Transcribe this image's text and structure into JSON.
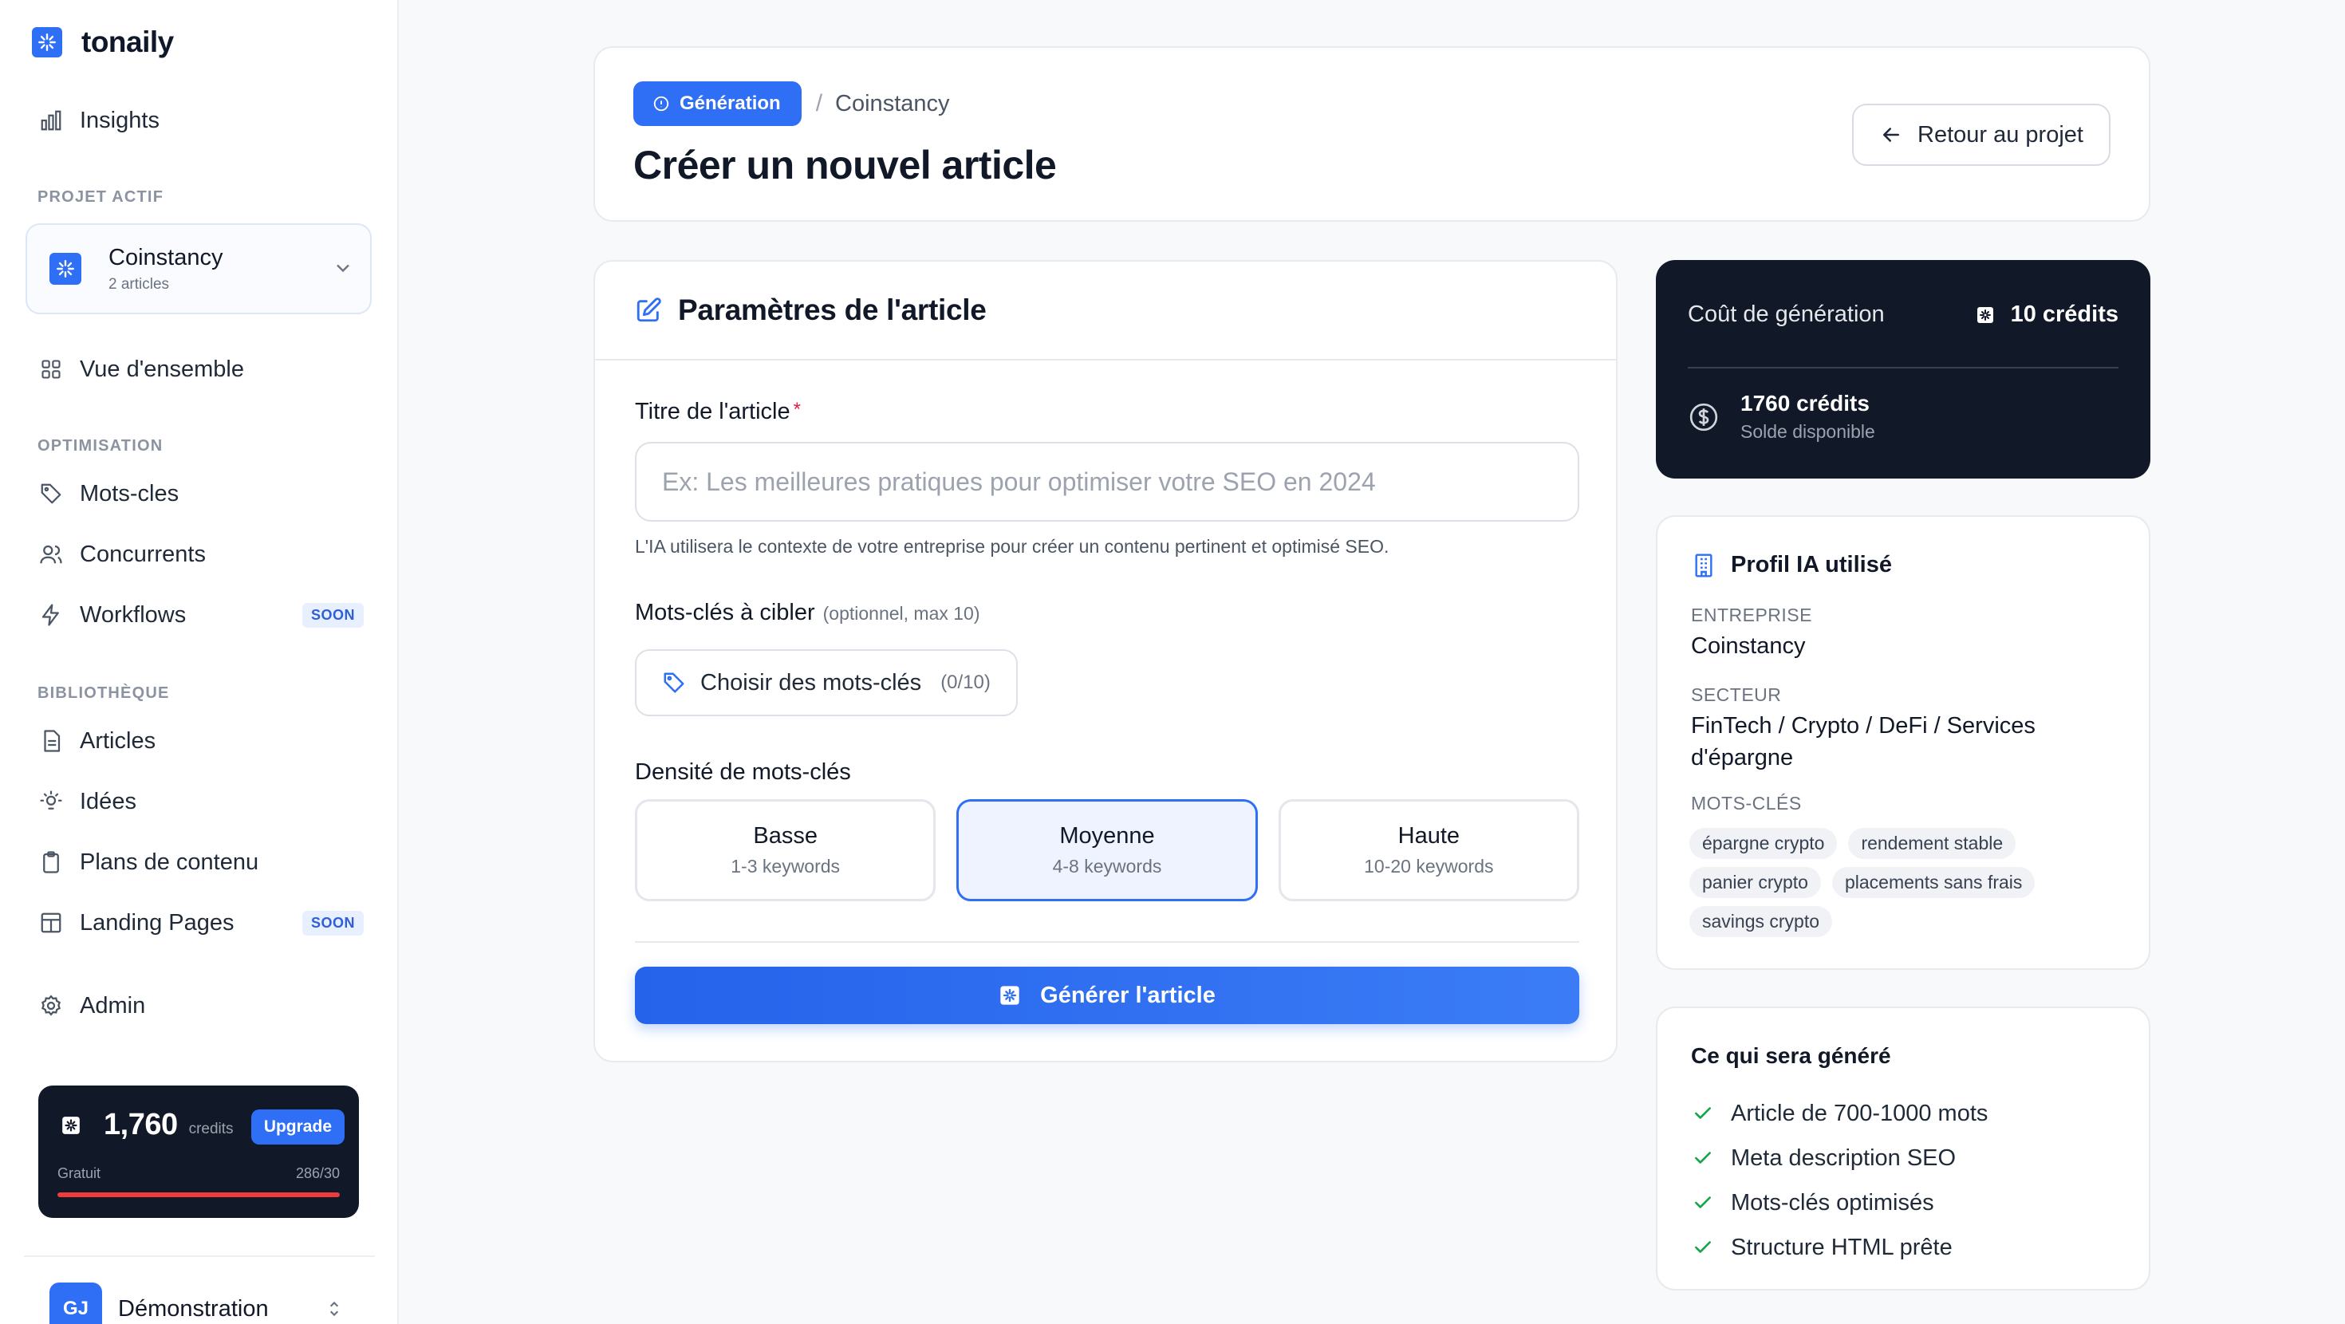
{
  "brand": {
    "name": "tonaily"
  },
  "sidebar": {
    "insights": "Insights",
    "active_project_label": "PROJET ACTIF",
    "project": {
      "name": "Coinstancy",
      "sub": "2 articles"
    },
    "overview": "Vue d'ensemble",
    "optimisation_label": "OPTIMISATION",
    "optimisation_items": [
      {
        "label": "Mots-cles",
        "icon": "tag-icon"
      },
      {
        "label": "Concurrents",
        "icon": "users-icon"
      },
      {
        "label": "Workflows",
        "icon": "bolt-icon",
        "badge": "SOON"
      }
    ],
    "library_label": "BIBLIOTHÈQUE",
    "library_items": [
      {
        "label": "Articles",
        "icon": "file-icon"
      },
      {
        "label": "Idées",
        "icon": "lightbulb-icon"
      },
      {
        "label": "Plans de contenu",
        "icon": "clipboard-icon"
      },
      {
        "label": "Landing Pages",
        "icon": "layout-icon",
        "badge": "SOON"
      }
    ],
    "admin": "Admin",
    "credits": {
      "amount": "1,760",
      "unit": "credits",
      "upgrade": "Upgrade",
      "plan": "Gratuit",
      "usage": "286/30",
      "usage_fraction": 1.0
    },
    "user": {
      "initials": "GJ",
      "name": "Démonstration"
    }
  },
  "header": {
    "badge": "Génération",
    "separator": "/",
    "breadcrumb_current": "Coinstancy",
    "title": "Créer un nouvel article",
    "back_button": "Retour au projet"
  },
  "form": {
    "section_title": "Paramètres de l'article",
    "title_label": "Titre de l'article",
    "required_mark": "*",
    "title_placeholder": "Ex: Les meilleures pratiques pour optimiser votre SEO en 2024",
    "title_value": "",
    "help": "L'IA utilisera le contexte de votre entreprise pour créer un contenu pertinent et optimisé SEO.",
    "keywords_label": "Mots-clés à cibler",
    "keywords_hint": "(optionnel, max 10)",
    "keywords_button": "Choisir des mots-clés",
    "keywords_count": "(0/10)",
    "density_label": "Densité de mots-clés",
    "density_options": [
      {
        "name": "Basse",
        "sub": "1-3 keywords",
        "selected": false
      },
      {
        "name": "Moyenne",
        "sub": "4-8 keywords",
        "selected": true
      },
      {
        "name": "Haute",
        "sub": "10-20 keywords",
        "selected": false
      }
    ],
    "generate_button": "Générer l'article"
  },
  "cost": {
    "label": "Coût de génération",
    "value": "10 crédits",
    "balance": "1760 crédits",
    "balance_label": "Solde disponible"
  },
  "profile": {
    "title": "Profil IA utilisé",
    "company_key": "ENTREPRISE",
    "company": "Coinstancy",
    "sector_key": "SECTEUR",
    "sector": "FinTech / Crypto / DeFi / Services d'épargne",
    "keywords_key": "MOTS-CLÉS",
    "keywords": [
      "épargne crypto",
      "rendement stable",
      "panier crypto",
      "placements sans frais",
      "savings crypto"
    ]
  },
  "output": {
    "title": "Ce qui sera généré",
    "items": [
      "Article de 700-1000 mots",
      "Meta description SEO",
      "Mots-clés optimisés",
      "Structure HTML prête"
    ]
  },
  "colors": {
    "accent": "#2f6ff5",
    "dark_card": "#111827",
    "danger": "#ef3b3b",
    "check": "#16a34a"
  }
}
